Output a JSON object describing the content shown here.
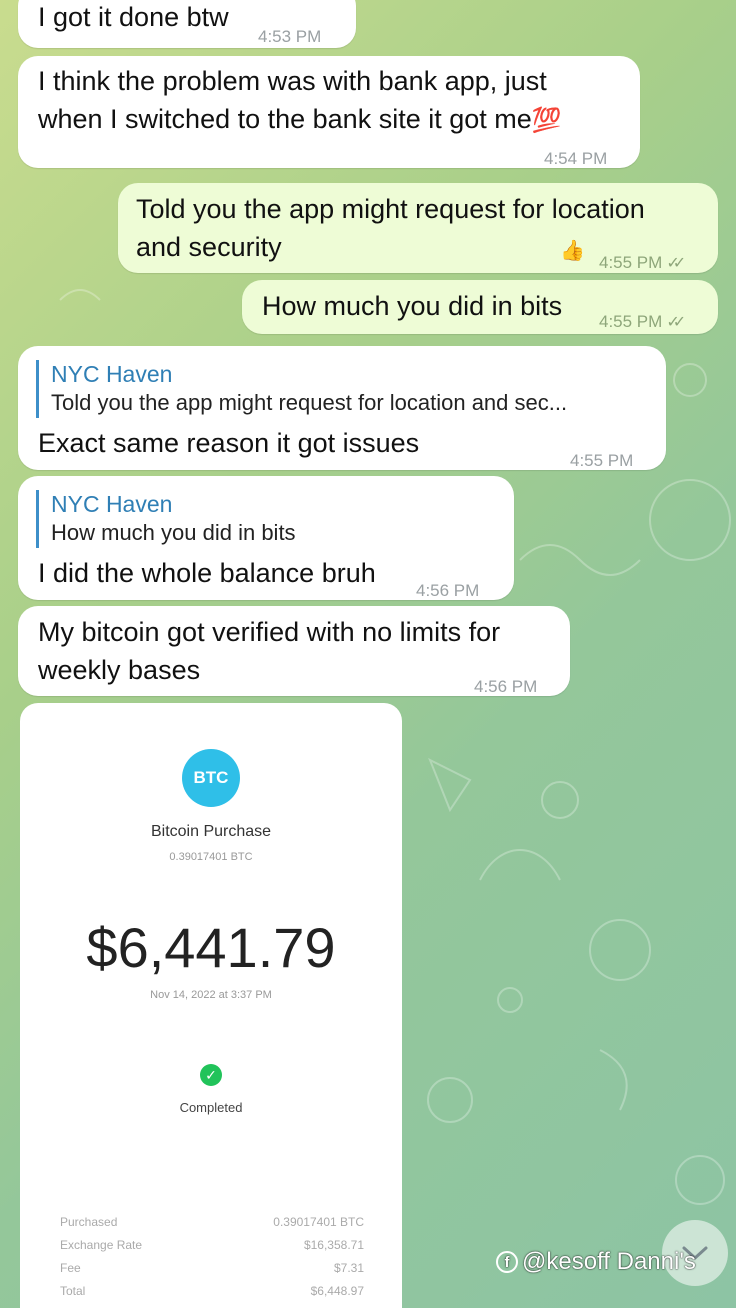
{
  "messages": [
    {
      "text": "I got it done btw",
      "time": "4:53 PM"
    },
    {
      "text_line1": "I think the problem was with bank app, just",
      "text_line2": "when I switched to the bank site it got me",
      "emoji": "💯",
      "time": "4:54 PM"
    },
    {
      "text_line1": "Told you the app might request for location",
      "text_line2": "and security",
      "reaction": "👍",
      "time": "4:55 PM"
    },
    {
      "text": "How much you did in bits",
      "time": "4:55 PM"
    },
    {
      "reply_name": "NYC Haven",
      "reply_text": "Told you the app might request for location and sec...",
      "text": "Exact same reason it got issues",
      "time": "4:55 PM"
    },
    {
      "reply_name": "NYC Haven",
      "reply_text": "How much you did in bits",
      "text": "I did the whole balance bruh",
      "time": "4:56 PM"
    },
    {
      "text_line1": "My bitcoin got verified with no limits for",
      "text_line2": "weekly bases",
      "time": "4:56 PM"
    }
  ],
  "receipt": {
    "badge": "BTC",
    "title": "Bitcoin Purchase",
    "sub_amount": "0.39017401 BTC",
    "amount": "$6,441.79",
    "date": "Nov 14, 2022 at 3:37 PM",
    "status": "Completed",
    "rows": [
      {
        "label": "Purchased",
        "value": "0.39017401 BTC"
      },
      {
        "label": "Exchange Rate",
        "value": "$16,358.71"
      },
      {
        "label": "Fee",
        "value": "$7.31"
      },
      {
        "label": "Total",
        "value": "$6,448.97"
      }
    ]
  },
  "watermark": "@kesoff Danni's",
  "icons": {
    "read": "double-check-icon",
    "scroll": "chevron-down-icon",
    "status": "check-circle-icon"
  }
}
